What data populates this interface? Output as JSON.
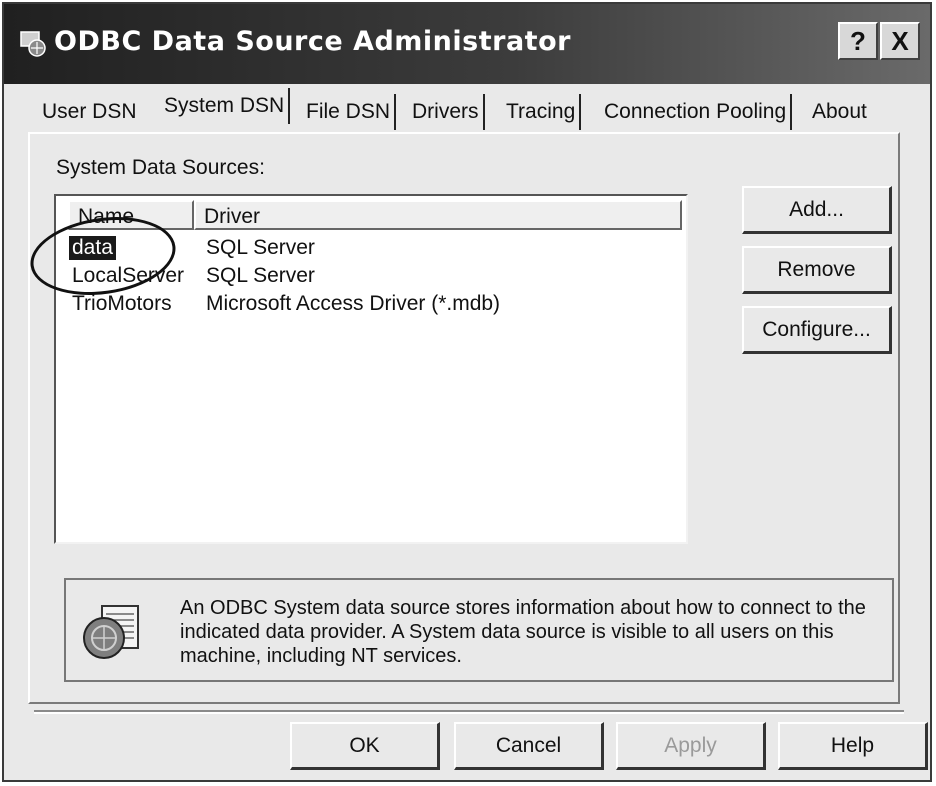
{
  "window": {
    "title": "ODBC Data Source Administrator",
    "help_glyph": "?",
    "close_glyph": "X"
  },
  "tabs": [
    {
      "label": "User DSN"
    },
    {
      "label": "System DSN",
      "active": true
    },
    {
      "label": "File DSN"
    },
    {
      "label": "Drivers"
    },
    {
      "label": "Tracing"
    },
    {
      "label": "Connection Pooling"
    },
    {
      "label": "About"
    }
  ],
  "panel": {
    "section_label": "System Data Sources:",
    "columns": {
      "name": "Name",
      "driver": "Driver"
    },
    "rows": [
      {
        "name": "data",
        "driver": "SQL Server",
        "selected": true
      },
      {
        "name": "LocalServer",
        "driver": "SQL Server"
      },
      {
        "name": "TrioMotors",
        "driver": "Microsoft Access Driver (*.mdb)"
      }
    ],
    "buttons": {
      "add": "Add...",
      "remove": "Remove",
      "configure": "Configure..."
    },
    "info_text": "An ODBC System data source stores information about how to connect to the indicated data provider.  A System data source is visible to all users on this machine, including NT services."
  },
  "footer": {
    "ok": "OK",
    "cancel": "Cancel",
    "apply": "Apply",
    "help": "Help"
  },
  "icons": {
    "title": "odbc-icon",
    "info": "database-info-icon"
  }
}
